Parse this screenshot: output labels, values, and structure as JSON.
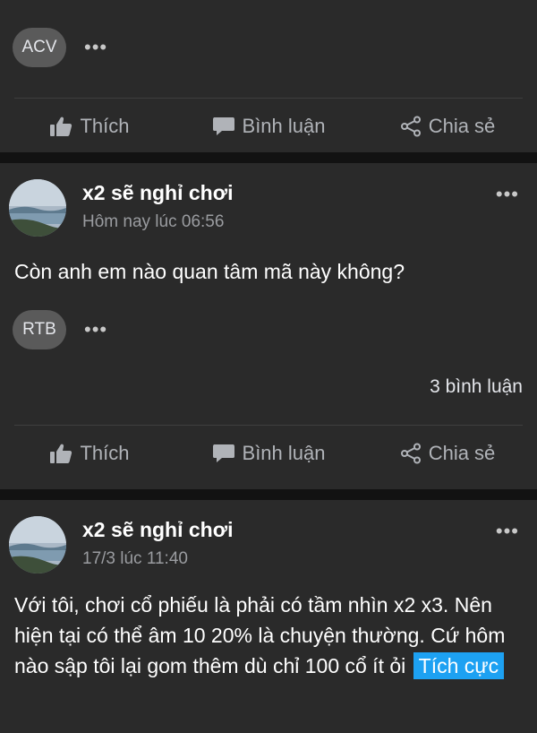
{
  "post_prev": {
    "ticker": "ACV",
    "more": "•••"
  },
  "actions": {
    "like": "Thích",
    "comment": "Bình luận",
    "share": "Chia sẻ"
  },
  "post1": {
    "author": "x2 sẽ nghỉ chơi",
    "time": "Hôm nay lúc 06:56",
    "text": "Còn anh em nào quan tâm mã này không?",
    "ticker": "RTB",
    "more": "•••",
    "header_more": "•••",
    "comments_count": "3 bình luận"
  },
  "post2": {
    "author": "x2 sẽ nghỉ chơi",
    "time": "17/3 lúc 11:40",
    "header_more": "•••",
    "text": "Với tôi, chơi cổ phiếu là phải có tầm nhìn x2 x3. Nên hiện tại có thể âm 10 20% là chuyện thường. Cứ hôm nào sập tôi lại gom thêm dù chỉ 100 cổ ít ỏi",
    "sentiment": "Tích cực"
  },
  "colors": {
    "background": "#121212",
    "card": "#2a2a2a",
    "sentiment": "#1da1f2"
  }
}
